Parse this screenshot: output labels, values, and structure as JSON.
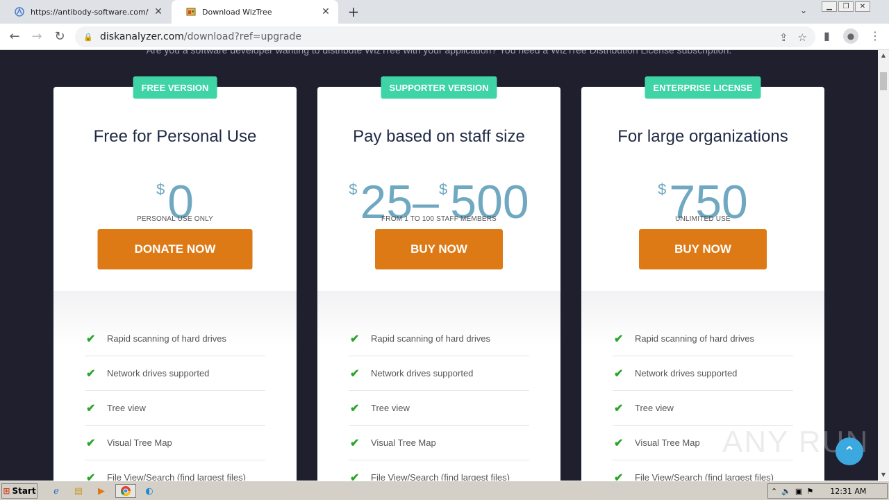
{
  "browser": {
    "tabs": [
      {
        "label": "https://antibody-software.com/files/",
        "icon": "app-icon"
      },
      {
        "label": "Download WizTree",
        "icon": "wiztree-icon"
      }
    ],
    "new_tab": "+",
    "url_host": "diskanalyzer.com",
    "url_path": "/download?ref=upgrade"
  },
  "page": {
    "intro": "Are you a software developer wanting to distribute WizTree with your application? You need a WizTree Distribution License subscription.",
    "plans": [
      {
        "badge": "FREE VERSION",
        "title": "Free for Personal Use",
        "currency": "$",
        "price": "0",
        "subtitle": "PERSONAL USE ONLY",
        "button": "DONATE NOW"
      },
      {
        "badge": "SUPPORTER VERSION",
        "title": "Pay based on staff size",
        "currency": "$",
        "price": "25–",
        "currency2": "$",
        "price2": "500",
        "subtitle": "FROM 1 TO 100 STAFF MEMBERS",
        "button": "BUY NOW"
      },
      {
        "badge": "ENTERPRISE LICENSE",
        "title": "For large organizations",
        "currency": "$",
        "price": "750",
        "subtitle": "UNLIMITED USE",
        "button": "BUY NOW"
      }
    ],
    "features": [
      "Rapid scanning of hard drives",
      "Network drives supported",
      "Tree view",
      "Visual Tree Map",
      "File View/Search (find largest files)"
    ],
    "watermark": "ANY RUN"
  },
  "taskbar": {
    "start": "Start",
    "clock": "12:31 AM"
  },
  "colors": {
    "badge": "#3fd4a5",
    "button": "#de7a16",
    "price": "#6fa8c0",
    "page_bg": "#1f1f2e"
  }
}
